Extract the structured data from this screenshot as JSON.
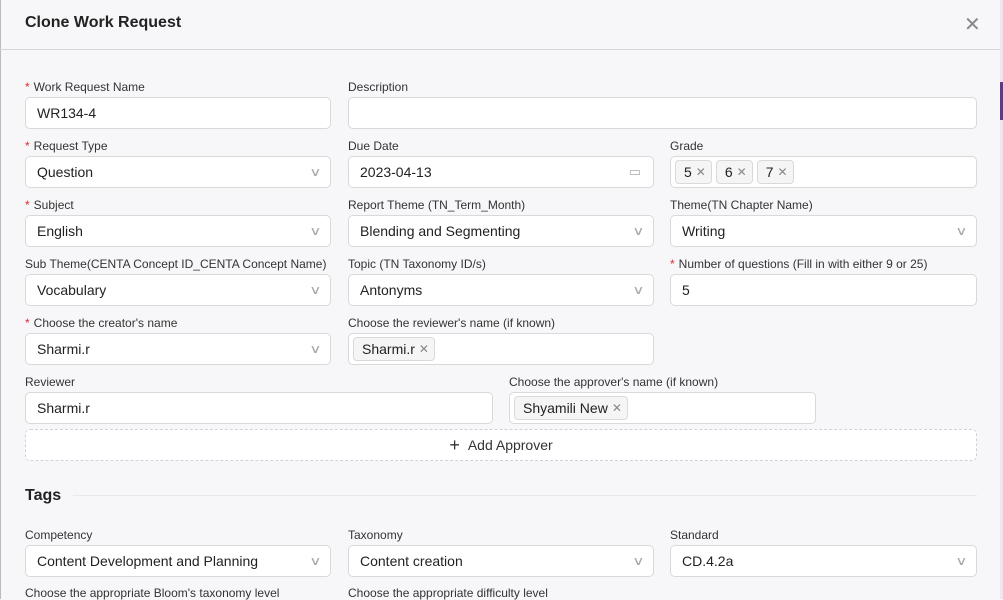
{
  "title": "Clone Work Request",
  "add_approver": "Add Approver",
  "tags_heading": "Tags",
  "colors": {
    "required": "#e0282e",
    "background": "#f7f7f9"
  },
  "fields": [
    {
      "label": "Work Request Name",
      "required": true,
      "type": "text",
      "value": "WR134-4"
    },
    {
      "label": "Description",
      "required": false,
      "type": "text",
      "value": ""
    },
    {
      "label": "Request Type",
      "required": true,
      "type": "select",
      "value": "Question"
    },
    {
      "label": "Due Date",
      "required": false,
      "type": "date",
      "value": "2023-04-13"
    },
    {
      "label": "Grade",
      "required": false,
      "type": "multi",
      "tags": [
        "5",
        "6",
        "7"
      ]
    },
    {
      "label": "Subject",
      "required": true,
      "type": "select",
      "value": "English"
    },
    {
      "label": "Report Theme (TN_Term_Month)",
      "required": false,
      "type": "select",
      "value": "Blending and Segmenting"
    },
    {
      "label": "Theme(TN Chapter Name)",
      "required": false,
      "type": "select",
      "value": "Writing"
    },
    {
      "label": "Sub Theme(CENTA Concept ID_CENTA Concept Name)",
      "required": false,
      "type": "select",
      "value": "Vocabulary"
    },
    {
      "label": "Topic (TN Taxonomy ID/s)",
      "required": false,
      "type": "select",
      "value": "Antonyms"
    },
    {
      "label": "Number of questions (Fill in with either 9 or 25)",
      "required": true,
      "type": "text",
      "value": "5"
    },
    {
      "label": "Choose the creator's name",
      "required": true,
      "type": "select",
      "value": "Sharmi.r"
    },
    {
      "label": "Choose the reviewer's name (if known)",
      "required": false,
      "type": "multi",
      "tags": [
        "Sharmi.r"
      ]
    },
    {
      "label": "Reviewer",
      "required": false,
      "type": "text",
      "value": "Sharmi.r"
    },
    {
      "label": "Choose the approver's name (if known)",
      "required": false,
      "type": "multi",
      "tags": [
        "Shyamili New"
      ]
    },
    {
      "label": "Competency",
      "required": false,
      "type": "select",
      "value": "Content Development and Planning"
    },
    {
      "label": "Taxonomy",
      "required": false,
      "type": "select",
      "value": "Content creation"
    },
    {
      "label": "Standard",
      "required": false,
      "type": "select",
      "value": "CD.4.2a"
    },
    {
      "label": "Choose the appropriate Bloom's taxonomy level",
      "required": false,
      "type": "none"
    },
    {
      "label": "Choose the appropriate difficulty level",
      "required": false,
      "type": "none"
    }
  ]
}
